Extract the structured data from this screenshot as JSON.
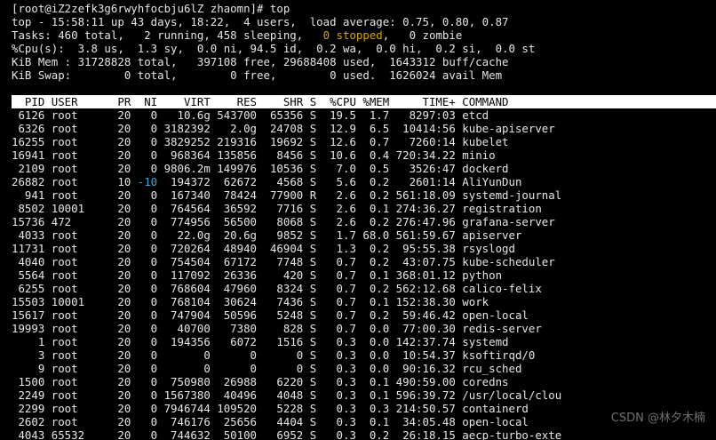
{
  "prompt_line": "[root@iZ2zefk3g6rwyhfocbju6lZ zhaomn]# top",
  "summary": {
    "uptime_line": "top - 15:58:11 up 43 days, 18:22,  4 users,  load average: 0.75, 0.80, 0.87",
    "tasks_prefix": "Tasks: 460 total,   2 running, 458 sleeping,   ",
    "tasks_stopped": "0 stopped",
    "tasks_suffix": ",   0 zombie",
    "cpu_line": "%Cpu(s):  3.8 us,  1.3 sy,  0.0 ni, 94.5 id,  0.2 wa,  0.0 hi,  0.2 si,  0.0 st",
    "mem_line": "KiB Mem : 31728828 total,   397108 free, 29688408 used,  1643312 buff/cache",
    "swap_line": "KiB Swap:        0 total,        0 free,        0 used.  1626024 avail Mem"
  },
  "table": {
    "header": "  PID USER      PR  NI    VIRT    RES    SHR S  %CPU %MEM     TIME+ COMMAND",
    "rows": [
      {
        "pre": " 6126 root      20   ",
        "ni": "0",
        "post": "   10.6g 543700  65356 S  19.5  1.7   8297:03 etcd"
      },
      {
        "pre": " 6326 root      20   ",
        "ni": "0",
        "post": " 3182392   2.0g  24708 S  12.9  6.5  10414:56 kube-apiserver"
      },
      {
        "pre": "16255 root      20   ",
        "ni": "0",
        "post": " 3829252 219316  19692 S  12.6  0.7   7260:14 kubelet"
      },
      {
        "pre": "16941 root      20   ",
        "ni": "0",
        "post": "  968364 135856   8456 S  10.6  0.4 720:34.22 minio"
      },
      {
        "pre": " 2109 root      20   ",
        "ni": "0",
        "post": " 9806.2m 149976  10536 S   7.0  0.5   3526:47 dockerd"
      },
      {
        "pre": "26882 root      10 ",
        "ni": "-10",
        "post": "  194372  62672   4568 S   5.6  0.2   2601:14 AliYunDun"
      },
      {
        "pre": "  941 root      20   ",
        "ni": "0",
        "post": "  167340  78424  77900 R   2.6  0.2 561:18.09 systemd-journal"
      },
      {
        "pre": " 8502 10001     20   ",
        "ni": "0",
        "post": "  764564  36592   7716 S   2.6  0.1 274:36.27 registration"
      },
      {
        "pre": "15736 472       20   ",
        "ni": "0",
        "post": "  774956  56500   8068 S   2.6  0.2 276:47.96 grafana-server"
      },
      {
        "pre": " 4033 root      20   ",
        "ni": "0",
        "post": "   22.0g  20.6g   9852 S   1.7 68.0 561:59.67 apiserver"
      },
      {
        "pre": "11731 root      20   ",
        "ni": "0",
        "post": "  720264  48940  46904 S   1.3  0.2  95:55.38 rsyslogd"
      },
      {
        "pre": " 4040 root      20   ",
        "ni": "0",
        "post": "  754504  67172   7748 S   0.7  0.2  43:07.75 kube-scheduler"
      },
      {
        "pre": " 5564 root      20   ",
        "ni": "0",
        "post": "  117092  26336    420 S   0.7  0.1 368:01.12 python"
      },
      {
        "pre": " 6255 root      20   ",
        "ni": "0",
        "post": "  768604  47960   8324 S   0.7  0.2 562:12.68 calico-felix"
      },
      {
        "pre": "15503 10001     20   ",
        "ni": "0",
        "post": "  768104  30624   7436 S   0.7  0.1 152:38.30 work"
      },
      {
        "pre": "15617 root      20   ",
        "ni": "0",
        "post": "  747904  50596   5248 S   0.7  0.2  59:46.42 open-local"
      },
      {
        "pre": "19993 root      20   ",
        "ni": "0",
        "post": "   40700   7380    828 S   0.7  0.0  77:00.30 redis-server"
      },
      {
        "pre": "    1 root      20   ",
        "ni": "0",
        "post": "  194356   6072   1516 S   0.3  0.0 142:37.74 systemd"
      },
      {
        "pre": "    3 root      20   ",
        "ni": "0",
        "post": "       0      0      0 S   0.3  0.0  10:54.37 ksoftirqd/0"
      },
      {
        "pre": "    9 root      20   ",
        "ni": "0",
        "post": "       0      0      0 S   0.3  0.0  90:16.32 rcu_sched"
      },
      {
        "pre": " 1500 root      20   ",
        "ni": "0",
        "post": "  750980  26988   6220 S   0.3  0.1 490:59.00 coredns"
      },
      {
        "pre": " 2249 root      20   ",
        "ni": "0",
        "post": " 1567380  40496   4048 S   0.3  0.1 596:39.72 /usr/local/clou"
      },
      {
        "pre": " 2299 root      20   ",
        "ni": "0",
        "post": " 7946744 109520   5228 S   0.3  0.3 214:50.57 containerd"
      },
      {
        "pre": " 2602 root      20   ",
        "ni": "0",
        "post": "  746176  25656   4404 S   0.3  0.1  34:05.48 open-local"
      },
      {
        "pre": " 4043 65532     20   ",
        "ni": "0",
        "post": "  744632  50100   6952 S   0.3  0.2  26:18.15 aecp-turbo-exte"
      }
    ]
  },
  "watermark": "CSDN @林夕木楠",
  "colors": {
    "background": "#000000",
    "foreground": "#e6e6e6",
    "stopped": "#d6a700",
    "negative_nice": "#3aa7d9",
    "header_bg": "#ffffff"
  }
}
